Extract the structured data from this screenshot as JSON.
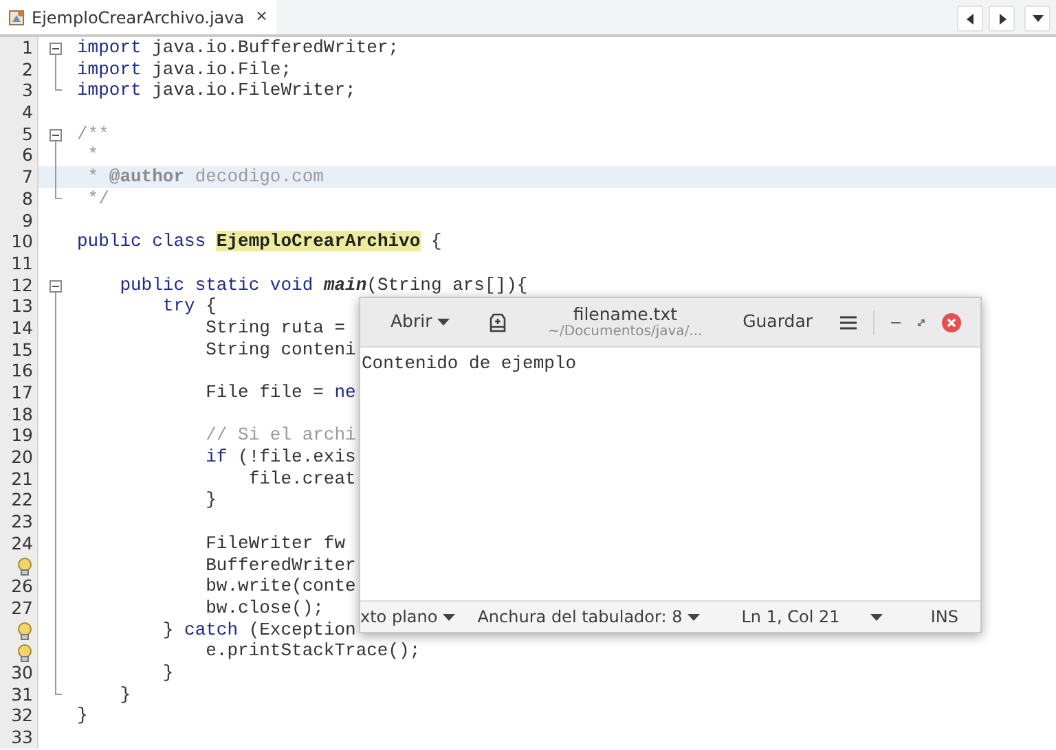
{
  "editor_tab": {
    "label": "EjemploCrearArchivo.java",
    "close": "×",
    "selected": true
  },
  "code_lines": [
    {
      "number": "1",
      "hint": false,
      "fold_toggle": true,
      "fold_end": false,
      "highlighted": false,
      "code": [
        {
          "kind": "keyword",
          "text": "import"
        },
        {
          "kind": "plain",
          "text": " java.io.BufferedWriter;"
        }
      ]
    },
    {
      "number": "2",
      "hint": false,
      "fold_toggle": false,
      "fold_end": false,
      "highlighted": false,
      "code": [
        {
          "kind": "keyword",
          "text": "import"
        },
        {
          "kind": "plain",
          "text": " java.io.File;"
        }
      ]
    },
    {
      "number": "3",
      "hint": false,
      "fold_toggle": false,
      "fold_end": true,
      "highlighted": false,
      "code": [
        {
          "kind": "keyword",
          "text": "import"
        },
        {
          "kind": "plain",
          "text": " java.io.FileWriter;"
        }
      ]
    },
    {
      "number": "4",
      "hint": false,
      "fold_toggle": false,
      "fold_end": false,
      "highlighted": false
    },
    {
      "number": "5",
      "hint": false,
      "fold_toggle": true,
      "fold_end": false,
      "highlighted": false,
      "code": [
        {
          "kind": "comment",
          "text": "/**"
        }
      ]
    },
    {
      "number": "6",
      "hint": false,
      "fold_toggle": false,
      "fold_end": false,
      "highlighted": false,
      "code": [
        {
          "kind": "comment",
          "text": " *"
        }
      ]
    },
    {
      "number": "7",
      "hint": false,
      "fold_toggle": false,
      "fold_end": false,
      "highlighted": true,
      "code": [
        {
          "kind": "comment",
          "text": " * "
        },
        {
          "kind": "tag",
          "text": "@author"
        },
        {
          "kind": "comment",
          "text": " decodigo.com"
        }
      ]
    },
    {
      "number": "8",
      "hint": false,
      "fold_toggle": false,
      "fold_end": true,
      "highlighted": false,
      "code": [
        {
          "kind": "comment",
          "text": " */"
        }
      ]
    },
    {
      "number": "9",
      "hint": false,
      "fold_toggle": false,
      "fold_end": false,
      "highlighted": false
    },
    {
      "number": "10",
      "hint": false,
      "fold_toggle": false,
      "fold_end": false,
      "highlighted": false,
      "code": [
        {
          "kind": "keyword",
          "text": "public class "
        },
        {
          "kind": "marked",
          "text": "EjemploCrearArchivo"
        },
        {
          "kind": "plain",
          "text": " {"
        }
      ]
    },
    {
      "number": "11",
      "hint": false,
      "fold_toggle": false,
      "fold_end": false,
      "highlighted": false
    },
    {
      "number": "12",
      "hint": false,
      "fold_toggle": true,
      "fold_end": false,
      "highlighted": false,
      "code": [
        {
          "kind": "keyword",
          "text": "    public static void "
        },
        {
          "kind": "method",
          "text": "main"
        },
        {
          "kind": "plain",
          "text": "(String ars[]){"
        }
      ]
    },
    {
      "number": "13",
      "hint": false,
      "fold_toggle": false,
      "fold_end": false,
      "highlighted": false,
      "code": [
        {
          "kind": "keyword",
          "text": "        try"
        },
        {
          "kind": "plain",
          "text": " {"
        }
      ]
    },
    {
      "number": "14",
      "hint": false,
      "fold_toggle": false,
      "fold_end": false,
      "highlighted": false,
      "code": [
        {
          "kind": "plain",
          "text": "            String ruta ="
        }
      ]
    },
    {
      "number": "15",
      "hint": false,
      "fold_toggle": false,
      "fold_end": false,
      "highlighted": false,
      "code": [
        {
          "kind": "plain",
          "text": "            String conteni"
        }
      ]
    },
    {
      "number": "16",
      "hint": false,
      "fold_toggle": false,
      "fold_end": false,
      "highlighted": false
    },
    {
      "number": "17",
      "hint": false,
      "fold_toggle": false,
      "fold_end": false,
      "highlighted": false,
      "code": [
        {
          "kind": "plain",
          "text": "            File file = "
        },
        {
          "kind": "keyword",
          "text": "ne"
        }
      ]
    },
    {
      "number": "18",
      "hint": false,
      "fold_toggle": false,
      "fold_end": false,
      "highlighted": false
    },
    {
      "number": "19",
      "hint": false,
      "fold_toggle": false,
      "fold_end": false,
      "highlighted": false,
      "code": [
        {
          "kind": "comment",
          "text": "            // Si el archi"
        }
      ]
    },
    {
      "number": "20",
      "hint": false,
      "fold_toggle": false,
      "fold_end": false,
      "highlighted": false,
      "code": [
        {
          "kind": "keyword",
          "text": "            if"
        },
        {
          "kind": "plain",
          "text": " (!file.exis"
        }
      ]
    },
    {
      "number": "21",
      "hint": false,
      "fold_toggle": false,
      "fold_end": false,
      "highlighted": false,
      "code": [
        {
          "kind": "plain",
          "text": "                file.creat"
        }
      ]
    },
    {
      "number": "22",
      "hint": false,
      "fold_toggle": false,
      "fold_end": false,
      "highlighted": false,
      "code": [
        {
          "kind": "plain",
          "text": "            }"
        }
      ]
    },
    {
      "number": "23",
      "hint": false,
      "fold_toggle": false,
      "fold_end": false,
      "highlighted": false
    },
    {
      "number": "24",
      "hint": false,
      "fold_toggle": false,
      "fold_end": false,
      "highlighted": false,
      "code": [
        {
          "kind": "plain",
          "text": "            FileWriter fw"
        }
      ]
    },
    {
      "hint": true,
      "fold_toggle": false,
      "fold_end": false,
      "highlighted": false,
      "code": [
        {
          "kind": "plain",
          "text": "            BufferedWriter"
        }
      ]
    },
    {
      "number": "26",
      "hint": false,
      "fold_toggle": false,
      "fold_end": false,
      "highlighted": false,
      "code": [
        {
          "kind": "plain",
          "text": "            bw.write(conte"
        }
      ]
    },
    {
      "number": "27",
      "hint": false,
      "fold_toggle": false,
      "fold_end": false,
      "highlighted": false,
      "code": [
        {
          "kind": "plain",
          "text": "            bw.close();"
        }
      ]
    },
    {
      "hint": true,
      "fold_toggle": false,
      "fold_end": false,
      "highlighted": false,
      "code": [
        {
          "kind": "plain",
          "text": "        } "
        },
        {
          "kind": "keyword",
          "text": "catch"
        },
        {
          "kind": "plain",
          "text": " (Exception"
        }
      ]
    },
    {
      "hint": true,
      "fold_toggle": false,
      "fold_end": false,
      "highlighted": false,
      "code": [
        {
          "kind": "plain",
          "text": "            e.printStackTrace();"
        }
      ]
    },
    {
      "number": "30",
      "hint": false,
      "fold_toggle": false,
      "fold_end": false,
      "highlighted": false,
      "code": [
        {
          "kind": "plain",
          "text": "        }"
        }
      ]
    },
    {
      "number": "31",
      "hint": false,
      "fold_toggle": false,
      "fold_end": true,
      "highlighted": false,
      "code": [
        {
          "kind": "plain",
          "text": "    }"
        }
      ]
    },
    {
      "number": "32",
      "hint": false,
      "fold_toggle": false,
      "fold_end": false,
      "highlighted": false,
      "code": [
        {
          "kind": "plain",
          "text": "}"
        }
      ]
    },
    {
      "number": "33",
      "hint": false,
      "fold_toggle": false,
      "fold_end": false,
      "highlighted": false
    }
  ],
  "text_editor_window": {
    "open_button": "Abrir",
    "title": "filename.txt",
    "subtitle": "~/Documentos/java/...",
    "save_button": "Guardar",
    "content": "Contenido de ejemplo",
    "status_bar": {
      "language": "xto plano",
      "tab_width": "Anchura del tabulador: 8",
      "position": "Ln 1, Col 21",
      "mode": "INS"
    }
  }
}
